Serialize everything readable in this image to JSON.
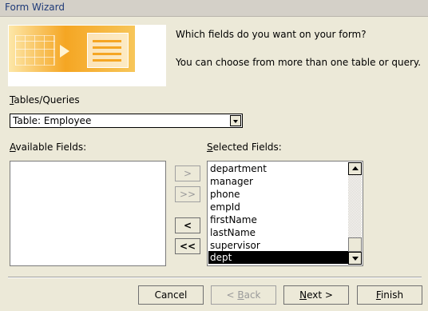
{
  "window": {
    "title": "Form Wizard"
  },
  "banner": {
    "icon": "form-wizard-illustration"
  },
  "prompt": {
    "question": "Which fields do you want on your form?",
    "hint": "You can choose from more than one table or query."
  },
  "tables": {
    "label_key": "T",
    "label_rest": "ables/Queries",
    "selected": "Table: Employee"
  },
  "available": {
    "label_key": "A",
    "label_rest": "vailable Fields:",
    "items": []
  },
  "selected_fields": {
    "label_key": "S",
    "label_rest": "elected Fields:",
    "items": [
      "department",
      "manager",
      "phone",
      "empId",
      "firstName",
      "lastName",
      "supervisor",
      "dept"
    ],
    "highlighted": "dept"
  },
  "move_buttons": {
    "add_one": ">",
    "add_all": ">>",
    "remove_one": "<",
    "remove_all": "<<"
  },
  "footer": {
    "cancel": "Cancel",
    "back_key": "B",
    "back_pre": "< ",
    "back_rest": "ack",
    "next_key": "N",
    "next_rest": "ext >",
    "finish_key": "F",
    "finish_rest": "inish"
  }
}
